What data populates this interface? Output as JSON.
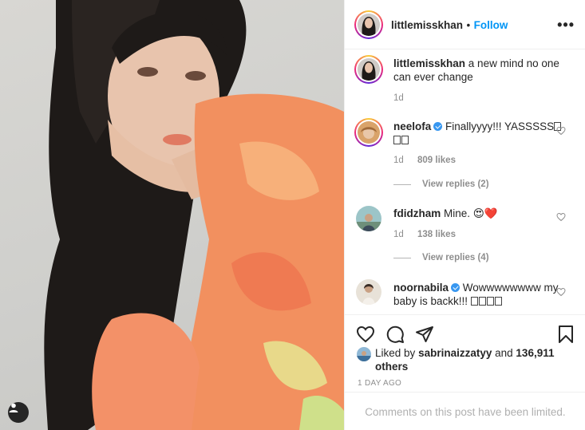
{
  "post": {
    "username": "littlemisskhan",
    "dot": "•",
    "follow_label": "Follow",
    "more_label": "•••"
  },
  "caption": {
    "username": "littlemisskhan",
    "text": "a new mind no one can ever change",
    "time": "1d"
  },
  "comments": [
    {
      "username": "neelofa",
      "verified": true,
      "text": "Finallyyyy!!! YASSSSS",
      "emoji_boxes": 3,
      "time": "1d",
      "likes": "809 likes",
      "replies": "View replies (2)"
    },
    {
      "username": "fdidzham",
      "verified": false,
      "text": "Mine.",
      "emoji": "😍❤️",
      "time": "1d",
      "likes": "138 likes",
      "replies": "View replies (4)"
    },
    {
      "username": "noornabila",
      "verified": true,
      "text": "Wowwwwwwww my baby is backk!!!",
      "emoji_boxes": 4
    }
  ],
  "likes_summary": {
    "prefix": "Liked by",
    "user": "sabrinaizzatyy",
    "and": "and",
    "count": "136,911 others"
  },
  "date_label": "1 DAY AGO",
  "comments_limited": "Comments on this post have been limited.",
  "colors": {
    "follow": "#0095f6",
    "muted": "#8e8e8e",
    "verified": "#3897f0"
  },
  "icons": [
    "heart-icon",
    "comment-icon",
    "share-icon",
    "bookmark-icon",
    "more-icon",
    "tagged-user-icon"
  ]
}
